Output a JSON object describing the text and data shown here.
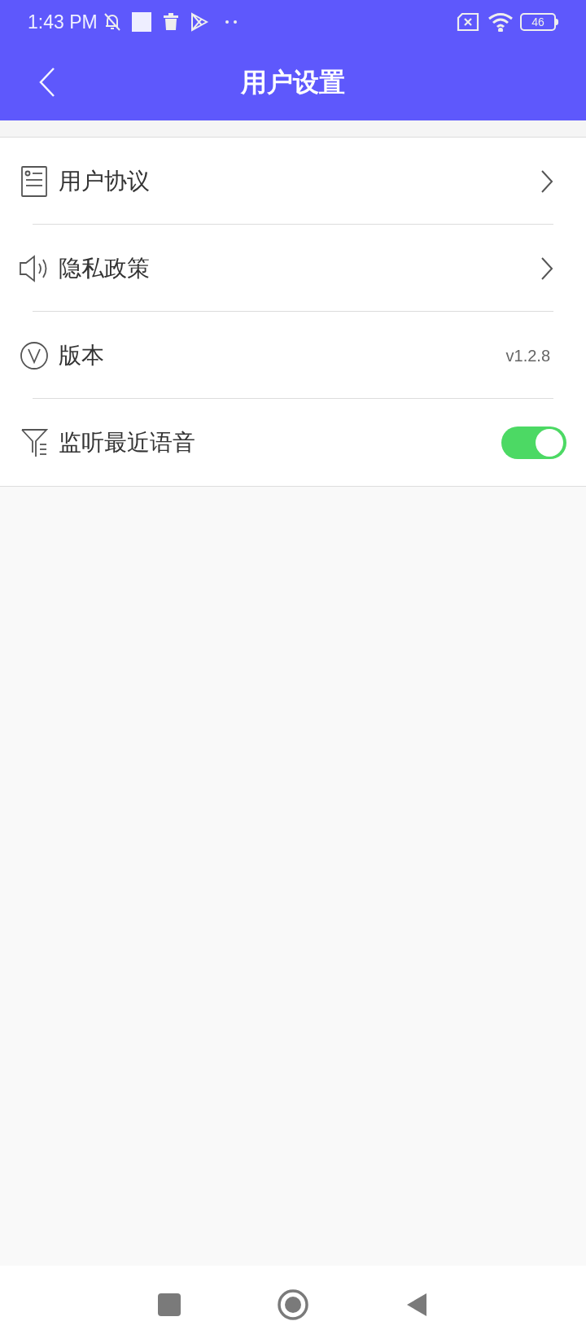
{
  "status_bar": {
    "time": "1:43 PM",
    "battery": "46"
  },
  "header": {
    "title": "用户设置"
  },
  "settings": [
    {
      "kind": "link",
      "label": "用户协议"
    },
    {
      "kind": "link",
      "label": "隐私政策"
    },
    {
      "kind": "value",
      "label": "版本",
      "value": "v1.2.8"
    },
    {
      "kind": "toggle",
      "label": "监听最近语音",
      "on": true
    }
  ]
}
